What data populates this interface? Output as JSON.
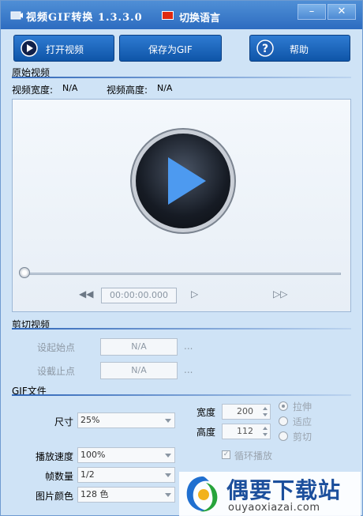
{
  "window": {
    "title": "视频GIF转换 1.3.3.0",
    "language_label": "切换语言",
    "minimize_label": "–",
    "close_label": "✕"
  },
  "toolbar": {
    "open_label": "打开视频",
    "save_label": "保存为GIF",
    "help_label": "帮助"
  },
  "original_video": {
    "section_title": "原始视频",
    "width_label": "视频宽度:",
    "width_value": "N/A",
    "height_label": "视频高度:",
    "height_value": "N/A",
    "time_display": "00:00:00.000",
    "seek_position": 0
  },
  "trim": {
    "section_title": "剪切视频",
    "start_label": "设起始点",
    "start_value": "N/A",
    "end_label": "设截止点",
    "end_value": "N/A",
    "dots": "..."
  },
  "gif": {
    "section_title": "GIF文件",
    "size_label": "尺寸",
    "size_value": "25%",
    "width_label": "宽度",
    "width_value": "200",
    "height_label": "高度",
    "height_value": "112",
    "resize_modes": [
      {
        "label": "拉伸",
        "selected": true
      },
      {
        "label": "适应",
        "selected": false
      },
      {
        "label": "剪切",
        "selected": false
      }
    ],
    "speed_label": "播放速度",
    "speed_value": "100%",
    "loop_label": "循环播放",
    "loop_checked": true,
    "frames_label": "帧数量",
    "frames_value": "1/2",
    "color_label": "图片颜色",
    "color_value": "128 色"
  },
  "watermark": {
    "title": "偶要下载站",
    "url": "ouyaoxiazai.com"
  },
  "colors": {
    "accent": "#1c63bd",
    "window_bg": "#cfe3f6"
  }
}
